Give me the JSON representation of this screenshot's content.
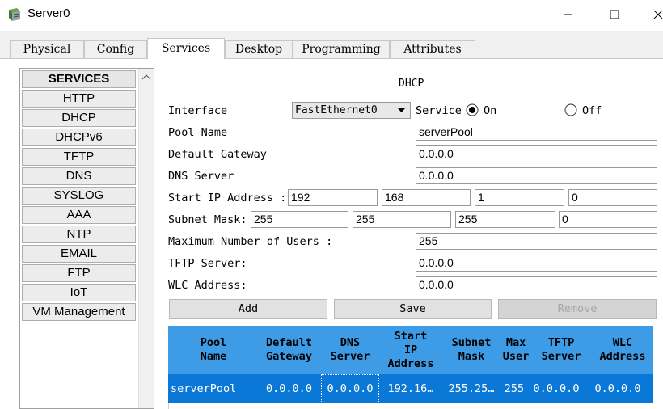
{
  "window": {
    "title": "Server0"
  },
  "tabs": [
    "Physical",
    "Config",
    "Services",
    "Desktop",
    "Programming",
    "Attributes"
  ],
  "active_tab": "Services",
  "services": {
    "header": "SERVICES",
    "items": [
      "HTTP",
      "DHCP",
      "DHCPv6",
      "TFTP",
      "DNS",
      "SYSLOG",
      "AAA",
      "NTP",
      "EMAIL",
      "FTP",
      "IoT",
      "VM Management"
    ]
  },
  "dhcp": {
    "title": "DHCP",
    "interface_label": "Interface",
    "interface_value": "FastEthernet0",
    "service_label": "Service",
    "on_label": "On",
    "off_label": "Off",
    "service_state": "on",
    "pool_name_label": "Pool Name",
    "pool_name": "serverPool",
    "gateway_label": "Default Gateway",
    "gateway": "0.0.0.0",
    "dns_label": "DNS Server",
    "dns": "0.0.0.0",
    "start_ip_label": "Start IP Address :",
    "start_ip": [
      "192",
      "168",
      "1",
      "0"
    ],
    "subnet_label": "Subnet Mask:",
    "subnet": [
      "255",
      "255",
      "255",
      "0"
    ],
    "max_users_label": "Maximum Number of Users :",
    "max_users": "255",
    "tftp_label": "TFTP Server:",
    "tftp": "0.0.0.0",
    "wlc_label": "WLC Address:",
    "wlc": "0.0.0.0",
    "buttons": {
      "add": "Add",
      "save": "Save",
      "remove": "Remove"
    }
  },
  "pool_table": {
    "headers": [
      [
        "Pool",
        "Name"
      ],
      [
        "Default",
        "Gateway"
      ],
      [
        "DNS",
        "Server"
      ],
      [
        "Start",
        "IP",
        "Address"
      ],
      [
        "Subnet",
        "Mask"
      ],
      [
        "Max",
        "User"
      ],
      [
        "TFTP",
        "Server"
      ],
      [
        "WLC",
        "Address"
      ]
    ],
    "rows": [
      [
        "serverPool",
        "0.0.0.0",
        "0.0.0.0",
        "192.16…",
        "255.25…",
        "255",
        "0.0.0.0",
        "0.0.0.0"
      ]
    ]
  },
  "colors": {
    "table_header": "#3e9be6",
    "table_selected_row": "#0a78d7"
  }
}
